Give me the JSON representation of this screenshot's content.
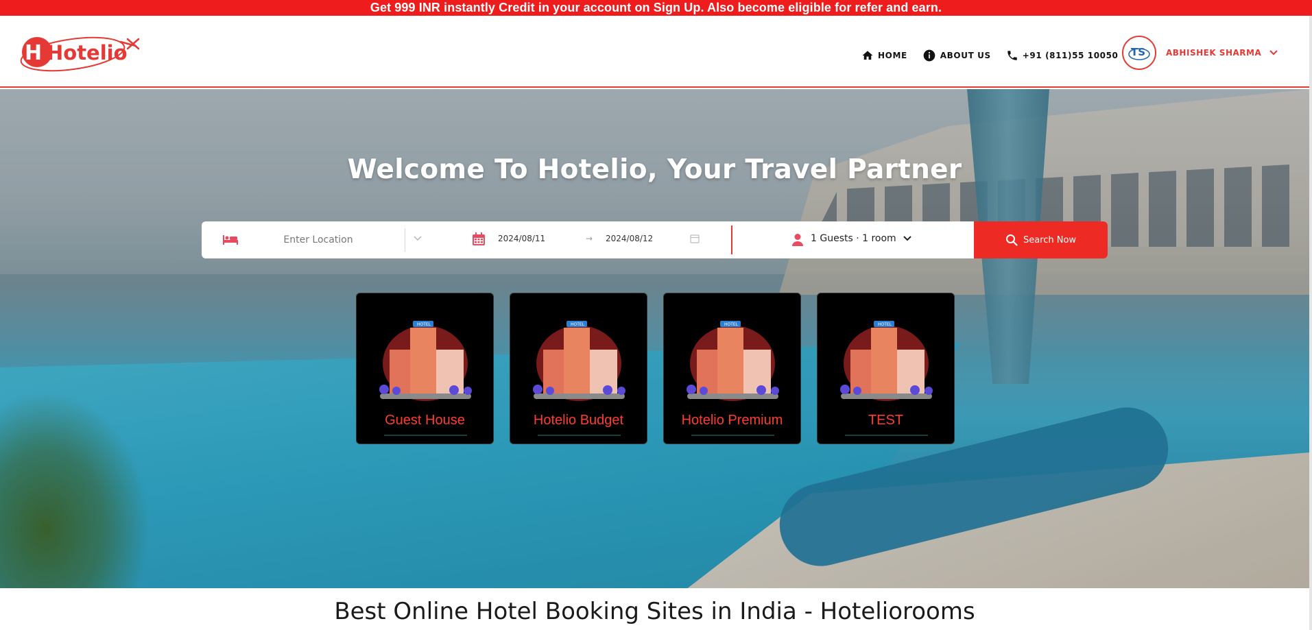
{
  "promo": {
    "text": "Get 999 INR instantly Credit in your account on Sign Up. Also become eligible for refer and earn."
  },
  "header": {
    "logo_text": "Hotelio",
    "nav": [
      {
        "label": "HOME",
        "icon": "home-icon"
      },
      {
        "label": "ABOUT US",
        "icon": "info-icon"
      },
      {
        "label": "+91 (811)55 10050",
        "icon": "phone-icon"
      }
    ],
    "user": {
      "name": "ABHISHEK SHARMA",
      "avatar_initials": "TS"
    }
  },
  "hero": {
    "title": "Welcome To Hotelio, Your Travel Partner",
    "search": {
      "location_placeholder": "Enter Location",
      "checkin": "2024/08/11",
      "arrow": "→",
      "checkout": "2024/08/12",
      "guests": "1 Guests · 1 room",
      "button_label": "Search Now"
    },
    "categories": [
      {
        "label": "Guest House",
        "sign": "HOTEL"
      },
      {
        "label": "Hotelio Budget",
        "sign": "HOTEL"
      },
      {
        "label": "Hotelio Premium",
        "sign": "HOTEL"
      },
      {
        "label": "TEST",
        "sign": "HOTEL"
      }
    ]
  },
  "section": {
    "title": "Best Online Hotel Booking Sites in India - Hoteliorooms"
  },
  "colors": {
    "accent": "#ee1c1c",
    "card_bg": "#000000",
    "card_label": "#ff3b30"
  }
}
